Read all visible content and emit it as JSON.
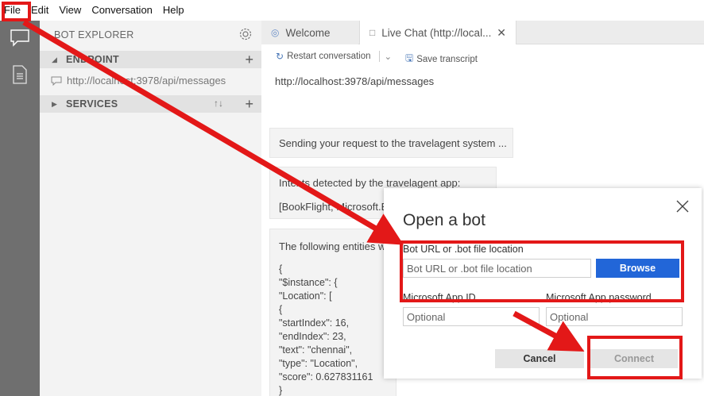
{
  "menu": {
    "file": "File",
    "edit": "Edit",
    "view": "View",
    "conversation": "Conversation",
    "help": "Help"
  },
  "activity_bar": {
    "items": [
      "chat-icon",
      "document-icon"
    ]
  },
  "explorer": {
    "title": "BOT EXPLORER",
    "endpoint_section": "ENDPOINT",
    "endpoint_url": "http://localhost:3978/api/messages",
    "services_section": "SERVICES"
  },
  "tabs": {
    "welcome": "Welcome",
    "livechat": "Live Chat (http://local..."
  },
  "toolbar": {
    "restart": "Restart conversation",
    "save_transcript": "Save transcript"
  },
  "chat": {
    "url": "http://localhost:3978/api/messages",
    "message1": "Sending your request to the travelagent system ...",
    "message2_line1": "Intents detected by the travelagent app:",
    "message2_line2": "[BookFlight, Microsoft.E",
    "message3_intro": "The following entities w",
    "json_lines": [
      "{",
      "\"$instance\": {",
      "\"Location\": [",
      "{",
      "\"startIndex\": 16,",
      "\"endIndex\": 23,",
      "\"text\": \"chennai\",",
      "\"type\": \"Location\",",
      "\"score\": 0.627831161",
      "}"
    ]
  },
  "dialog": {
    "title": "Open a bot",
    "bot_url_label": "Bot URL or .bot file location",
    "bot_url_placeholder": "Bot URL or .bot file location",
    "browse": "Browse",
    "app_id_label": "Microsoft App ID",
    "app_id_placeholder": "Optional",
    "app_password_label": "Microsoft App password",
    "app_password_placeholder": "Optional",
    "cancel": "Cancel",
    "connect": "Connect"
  },
  "colors": {
    "activity_bar": "#6f6f6f",
    "explorer_bg": "#f3f3f3",
    "accent_blue": "#2266d8",
    "annotation_red": "#e31818"
  }
}
